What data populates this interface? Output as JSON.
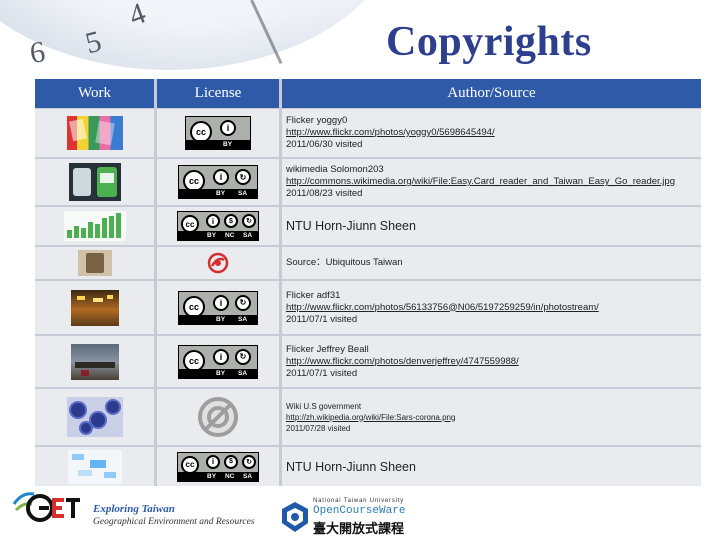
{
  "slide": {
    "title": "Copyrights",
    "colors": {
      "title": "#2d3f8e",
      "header_bg": "#2e5aa8",
      "row_bg": "#eaebef"
    }
  },
  "table": {
    "headers": [
      "Work",
      "License",
      "Author/Source"
    ],
    "rows": [
      {
        "work_image": "colorful-easycards-photo",
        "license": "cc-by",
        "license_labels": [
          "BY"
        ],
        "author": "Flicker yoggy0",
        "link": "http://www.flickr.com/photos/yoggy0/5698645494/",
        "visited": "2011/06/30 visited"
      },
      {
        "work_image": "card-reader-photo",
        "license": "cc-by-sa",
        "license_labels": [
          "BY",
          "SA"
        ],
        "author": "wikimedia  Solomon203",
        "link": "http://commons.wikimedia.org/wiki/File:Easy.Card_reader_and_Taiwan_Easy_Go_reader.jpg",
        "visited": "2011/08/23 visited"
      },
      {
        "work_image": "bar-chart-image",
        "license": "cc-by-nc-sa",
        "license_labels": [
          "BY",
          "NC",
          "SA"
        ],
        "author": "NTU Horn-Jiunn Sheen",
        "link": "",
        "visited": ""
      },
      {
        "work_image": "bag-photo",
        "license": "source-logo",
        "license_labels": [],
        "author": "Source：Ubiquitous Taiwan",
        "link": "",
        "visited": ""
      },
      {
        "work_image": "night-street-photo",
        "license": "cc-by-sa",
        "license_labels": [
          "BY",
          "SA"
        ],
        "author": "Flicker adf31",
        "link": "http://www.flickr.com/photos/56133756@N06/5197259259/in/photostream/",
        "visited": "2011/07/1 visited"
      },
      {
        "work_image": "crowd-hall-photo",
        "license": "cc-by-sa",
        "license_labels": [
          "BY",
          "SA"
        ],
        "author": "Flicker Jeffrey Beall",
        "link": "http://www.flickr.com/photos/denverjeffrey/4747559988/",
        "visited": "2011/07/1 visited"
      },
      {
        "work_image": "virus-micrograph",
        "license": "public-domain",
        "license_labels": [],
        "author": "Wiki U.S government",
        "link": "http://zh.wikipedia.org/wiki/File:Sars-corona.png",
        "visited": "2011/07/28 visited"
      },
      {
        "work_image": "diagram-image",
        "license": "cc-by-nc-sa",
        "license_labels": [
          "BY",
          "NC",
          "SA"
        ],
        "author": "NTU Horn-Jiunn Sheen",
        "link": "",
        "visited": ""
      }
    ]
  },
  "footer": {
    "get_logo": "GET",
    "et_line1": "Exploring Taiwan",
    "et_line2": "Geographical Environment and Resources",
    "ntu_line1": "National Taiwan University",
    "ntu_line2": "OpenCourseWare",
    "ntu_line3": "臺大開放式課程"
  }
}
